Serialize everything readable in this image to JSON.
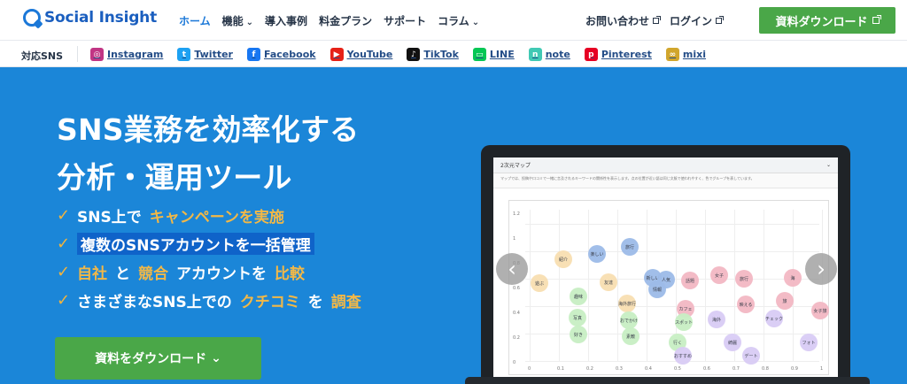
{
  "header": {
    "logo": "Social Insight",
    "nav": [
      {
        "label": "ホーム"
      },
      {
        "label": "機能",
        "arrow": "⌄"
      },
      {
        "label": "導入事例"
      },
      {
        "label": "料金プラン"
      },
      {
        "label": "サポート"
      },
      {
        "label": "コラム",
        "arrow": "⌄"
      }
    ],
    "right": {
      "contact": "お問い合わせ",
      "login": "ログイン",
      "download": "資料ダウンロード"
    }
  },
  "sns": {
    "title": "対応SNS",
    "items": [
      {
        "label": "Instagram",
        "icon": "instagram-icon",
        "color": "#c13584",
        "glyph": "◎"
      },
      {
        "label": "Twitter",
        "icon": "twitter-icon",
        "color": "#1da1f2",
        "glyph": "t"
      },
      {
        "label": "Facebook",
        "icon": "facebook-icon",
        "color": "#1877f2",
        "glyph": "f"
      },
      {
        "label": "YouTube",
        "icon": "youtube-icon",
        "color": "#e62117",
        "glyph": "▶"
      },
      {
        "label": "TikTok",
        "icon": "tiktok-icon",
        "color": "#111111",
        "glyph": "♪"
      },
      {
        "label": "LINE",
        "icon": "line-icon",
        "color": "#06c755",
        "glyph": "▭"
      },
      {
        "label": "note",
        "icon": "note-icon",
        "color": "#41c9b4",
        "glyph": "n"
      },
      {
        "label": "Pinterest",
        "icon": "pinterest-icon",
        "color": "#e60023",
        "glyph": "p"
      },
      {
        "label": "mixi",
        "icon": "mixi-icon",
        "color": "#d1a62d",
        "glyph": "∞"
      }
    ]
  },
  "hero": {
    "headline_line1": "SNS業務を効率化する",
    "headline_line2": "分析・運用ツール",
    "features": [
      {
        "parts": [
          {
            "text": "SNS上で"
          },
          {
            "text": "キャンペーンを実施",
            "tone": "orange"
          }
        ]
      },
      {
        "parts": [
          {
            "text": "複数のSNSアカウントを一括管理",
            "tone": "highlight"
          }
        ]
      },
      {
        "parts": [
          {
            "text": "自社",
            "tone": "orange"
          },
          {
            "text": "と"
          },
          {
            "text": "競合",
            "tone": "orange"
          },
          {
            "text": "アカウントを"
          },
          {
            "text": "比較",
            "tone": "orange"
          }
        ]
      },
      {
        "parts": [
          {
            "text": "さまざまなSNS上での"
          },
          {
            "text": "クチコミ",
            "tone": "orange"
          },
          {
            "text": "を"
          },
          {
            "text": "調査",
            "tone": "orange"
          }
        ]
      }
    ],
    "button": "資料をダウンロード",
    "button_arrow": "⌄"
  },
  "preview": {
    "title": "2次元マップ",
    "note": "マップでは、投稿や口コミで一緒に言及されるキーワードの関係性を表示します。点の位置が近い語は同じ文脈で使われやすく、色でグループを表しています。",
    "y_ticks": [
      "1.2",
      "1",
      "0.8",
      "0.6",
      "0.4",
      "0.2",
      "0"
    ],
    "x_ticks": [
      "0",
      "0.1",
      "0.2",
      "0.3",
      "0.4",
      "0.5",
      "0.6",
      "0.7",
      "0.8",
      "0.9",
      "1"
    ],
    "bubbles": [
      {
        "label": "遊ぶ",
        "group": "yellow"
      },
      {
        "label": "紹介",
        "group": "yellow"
      },
      {
        "label": "楽しい",
        "group": "blue"
      },
      {
        "label": "友達",
        "group": "yellow"
      },
      {
        "label": "趣味",
        "group": "green"
      },
      {
        "label": "写真",
        "group": "green"
      },
      {
        "label": "好き",
        "group": "green"
      },
      {
        "label": "旅行",
        "group": "blue"
      },
      {
        "label": "新しい",
        "group": "blue"
      },
      {
        "label": "情報",
        "group": "blue"
      },
      {
        "label": "海外旅行",
        "group": "yellow"
      },
      {
        "label": "おでかけ",
        "group": "green"
      },
      {
        "label": "素敵",
        "group": "green"
      },
      {
        "label": "人気",
        "group": "blue"
      },
      {
        "label": "話題",
        "group": "pink"
      },
      {
        "label": "カフェ",
        "group": "pink"
      },
      {
        "label": "スポット",
        "group": "green"
      },
      {
        "label": "行く",
        "group": "green"
      },
      {
        "label": "おすすめ",
        "group": "purple"
      },
      {
        "label": "女子",
        "group": "pink"
      },
      {
        "label": "旅行",
        "group": "pink"
      },
      {
        "label": "映える",
        "group": "pink"
      },
      {
        "label": "海外",
        "group": "purple"
      },
      {
        "label": "綺麗",
        "group": "purple"
      },
      {
        "label": "デート",
        "group": "purple"
      },
      {
        "label": "チェック",
        "group": "purple"
      },
      {
        "label": "旅",
        "group": "pink"
      },
      {
        "label": "海",
        "group": "pink"
      },
      {
        "label": "女子旅",
        "group": "pink"
      },
      {
        "label": "フォト",
        "group": "purple"
      }
    ]
  }
}
